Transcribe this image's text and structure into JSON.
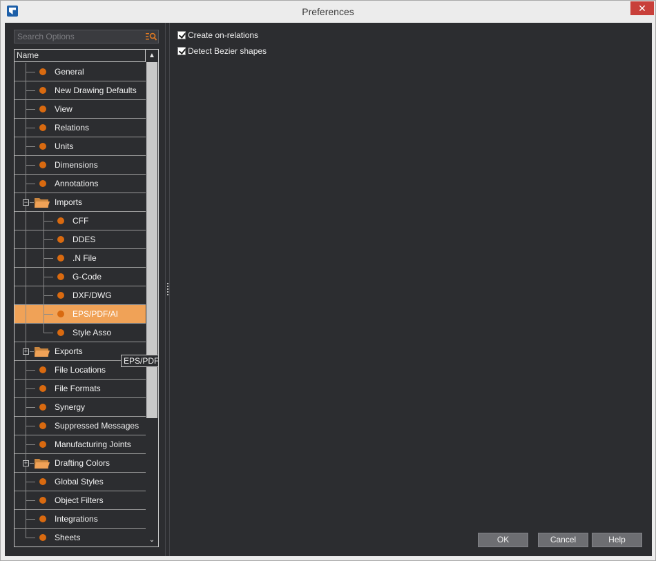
{
  "window": {
    "title": "Preferences",
    "close_glyph": "✕",
    "app_icon": "app-logo-icon"
  },
  "search": {
    "placeholder": "Search Options",
    "value": "",
    "icon": "search-list-icon"
  },
  "tree": {
    "header": "Name",
    "items": [
      {
        "label": "General",
        "level": 0,
        "type": "item"
      },
      {
        "label": "New Drawing Defaults",
        "level": 0,
        "type": "item"
      },
      {
        "label": "View",
        "level": 0,
        "type": "item"
      },
      {
        "label": "Relations",
        "level": 0,
        "type": "item"
      },
      {
        "label": "Units",
        "level": 0,
        "type": "item"
      },
      {
        "label": "Dimensions",
        "level": 0,
        "type": "item"
      },
      {
        "label": "Annotations",
        "level": 0,
        "type": "item"
      },
      {
        "label": "Imports",
        "level": 0,
        "type": "folder",
        "expanded": true
      },
      {
        "label": "CFF",
        "level": 1,
        "type": "item"
      },
      {
        "label": "DDES",
        "level": 1,
        "type": "item"
      },
      {
        "label": ".N File",
        "level": 1,
        "type": "item"
      },
      {
        "label": "G-Code",
        "level": 1,
        "type": "item"
      },
      {
        "label": "DXF/DWG",
        "level": 1,
        "type": "item"
      },
      {
        "label": "EPS/PDF/AI",
        "level": 1,
        "type": "item",
        "selected": true
      },
      {
        "label": "Style Asso",
        "level": 1,
        "type": "item",
        "last_child": true
      },
      {
        "label": "Exports",
        "level": 0,
        "type": "folder",
        "expanded": false
      },
      {
        "label": "File Locations",
        "level": 0,
        "type": "item"
      },
      {
        "label": "File Formats",
        "level": 0,
        "type": "item"
      },
      {
        "label": "Synergy",
        "level": 0,
        "type": "item"
      },
      {
        "label": "Suppressed Messages",
        "level": 0,
        "type": "item"
      },
      {
        "label": "Manufacturing Joints",
        "level": 0,
        "type": "item"
      },
      {
        "label": "Drafting Colors",
        "level": 0,
        "type": "folder",
        "expanded": false
      },
      {
        "label": "Global Styles",
        "level": 0,
        "type": "item"
      },
      {
        "label": "Object Filters",
        "level": 0,
        "type": "item"
      },
      {
        "label": "Integrations",
        "level": 0,
        "type": "item"
      },
      {
        "label": "Sheets",
        "level": 0,
        "type": "item"
      }
    ],
    "tooltip": "EPS/PDF/AI",
    "scroll_up_glyph": "▲",
    "scroll_down_glyph": "⌄",
    "expanded_glyph": "−",
    "collapsed_glyph": "+"
  },
  "options": [
    {
      "label": "Create on-relations",
      "checked": true
    },
    {
      "label": "Detect Bezier shapes",
      "checked": true
    }
  ],
  "buttons": {
    "ok": "OK",
    "cancel": "Cancel",
    "help": "Help"
  },
  "colors": {
    "panel_bg": "#2c2d30",
    "selection": "#f0a257",
    "accent_dot": "#d96a10",
    "folder": "#f0a257",
    "close_red": "#c8403a"
  }
}
